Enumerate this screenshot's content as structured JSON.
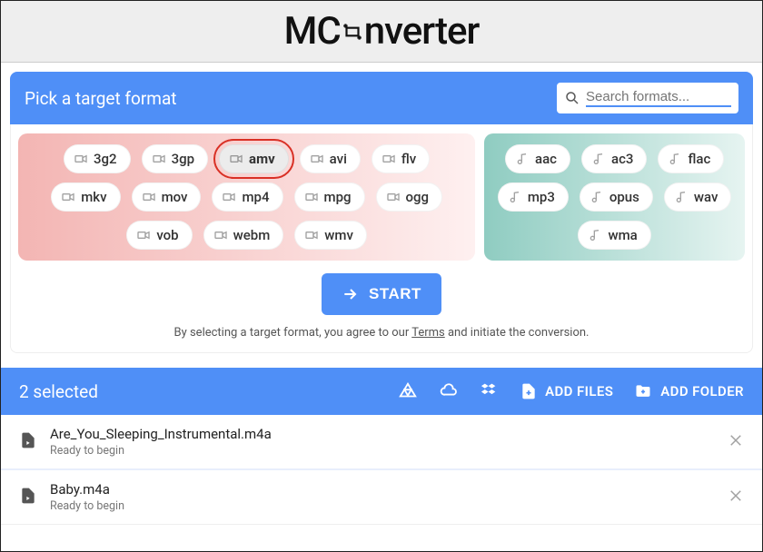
{
  "brand": {
    "part1": "MC",
    "part2": "nverter"
  },
  "picker": {
    "title": "Pick a target format",
    "search_placeholder": "Search formats..."
  },
  "video_formats": [
    "3g2",
    "3gp",
    "amv",
    "avi",
    "flv",
    "mkv",
    "mov",
    "mp4",
    "mpg",
    "ogg",
    "vob",
    "webm",
    "wmv"
  ],
  "audio_formats": [
    "aac",
    "ac3",
    "flac",
    "mp3",
    "opus",
    "wav",
    "wma"
  ],
  "selected_format": "amv",
  "start_label": "START",
  "disclaimer_pre": "By selecting a target format, you agree to our ",
  "disclaimer_link": "Terms",
  "disclaimer_post": " and initiate the conversion.",
  "files_bar": {
    "count_label": "2 selected",
    "add_files": "ADD FILES",
    "add_folder": "ADD FOLDER"
  },
  "files": [
    {
      "name": "Are_You_Sleeping_Instrumental.m4a",
      "status": "Ready to begin"
    },
    {
      "name": "Baby.m4a",
      "status": "Ready to begin"
    }
  ]
}
